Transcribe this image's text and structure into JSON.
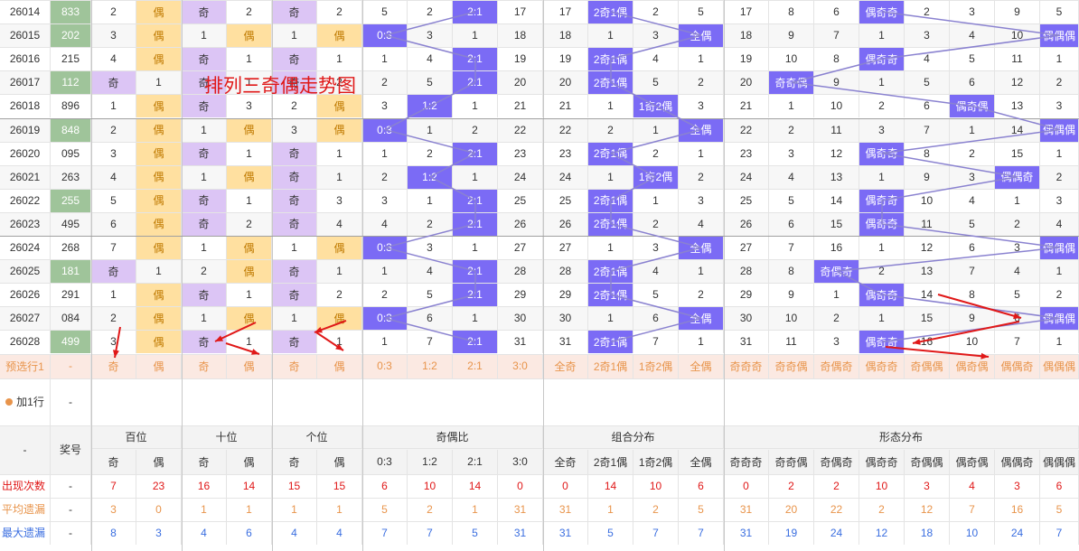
{
  "overlay_title": "排列三奇偶走势图",
  "rows": [
    [
      "26014",
      "833",
      "2",
      "偶",
      "奇",
      "2",
      "奇",
      "2",
      "5",
      "2",
      "2:1",
      "17",
      "17",
      "2奇1偶",
      "2",
      "5",
      "17",
      "8",
      "6",
      "偶奇奇",
      "2",
      "3",
      "9",
      "5"
    ],
    [
      "26015",
      "202",
      "3",
      "偶",
      "1",
      "偶",
      "1",
      "偶",
      "0:3",
      "3",
      "1",
      "18",
      "18",
      "1",
      "3",
      "全偶",
      "18",
      "9",
      "7",
      "1",
      "3",
      "4",
      "10",
      "偶偶偶"
    ],
    [
      "26016",
      "215",
      "4",
      "偶",
      "奇",
      "1",
      "奇",
      "1",
      "1",
      "4",
      "2:1",
      "19",
      "19",
      "2奇1偶",
      "4",
      "1",
      "19",
      "10",
      "8",
      "偶奇奇",
      "4",
      "5",
      "11",
      "1"
    ],
    [
      "26017",
      "112",
      "奇",
      "1",
      "奇",
      "1",
      "奇",
      "2",
      "2",
      "5",
      "2:1",
      "20",
      "20",
      "2奇1偶",
      "5",
      "2",
      "20",
      "奇奇偶",
      "9",
      "1",
      "5",
      "6",
      "12",
      "2"
    ],
    [
      "26018",
      "896",
      "1",
      "偶",
      "奇",
      "3",
      "2",
      "偶",
      "3",
      "1:2",
      "1",
      "21",
      "21",
      "1",
      "1奇2偶",
      "3",
      "21",
      "1",
      "10",
      "2",
      "6",
      "偶奇偶",
      "13",
      "3"
    ],
    [
      "26019",
      "848",
      "2",
      "偶",
      "1",
      "偶",
      "3",
      "偶",
      "0:3",
      "1",
      "2",
      "22",
      "22",
      "2",
      "1",
      "全偶",
      "22",
      "2",
      "11",
      "3",
      "7",
      "1",
      "14",
      "偶偶偶"
    ],
    [
      "26020",
      "095",
      "3",
      "偶",
      "奇",
      "1",
      "奇",
      "1",
      "1",
      "2",
      "2:1",
      "23",
      "23",
      "2奇1偶",
      "2",
      "1",
      "23",
      "3",
      "12",
      "偶奇奇",
      "8",
      "2",
      "15",
      "1"
    ],
    [
      "26021",
      "263",
      "4",
      "偶",
      "1",
      "偶",
      "奇",
      "1",
      "2",
      "1:2",
      "1",
      "24",
      "24",
      "1",
      "1奇2偶",
      "2",
      "24",
      "4",
      "13",
      "1",
      "9",
      "3",
      "偶偶奇",
      "2"
    ],
    [
      "26022",
      "255",
      "5",
      "偶",
      "奇",
      "1",
      "奇",
      "3",
      "3",
      "1",
      "2:1",
      "25",
      "25",
      "2奇1偶",
      "1",
      "3",
      "25",
      "5",
      "14",
      "偶奇奇",
      "10",
      "4",
      "1",
      "3"
    ],
    [
      "26023",
      "495",
      "6",
      "偶",
      "奇",
      "2",
      "奇",
      "4",
      "4",
      "2",
      "2:1",
      "26",
      "26",
      "2奇1偶",
      "2",
      "4",
      "26",
      "6",
      "15",
      "偶奇奇",
      "11",
      "5",
      "2",
      "4"
    ],
    [
      "26024",
      "268",
      "7",
      "偶",
      "1",
      "偶",
      "1",
      "偶",
      "0:3",
      "3",
      "1",
      "27",
      "27",
      "1",
      "3",
      "全偶",
      "27",
      "7",
      "16",
      "1",
      "12",
      "6",
      "3",
      "偶偶偶"
    ],
    [
      "26025",
      "181",
      "奇",
      "1",
      "2",
      "偶",
      "奇",
      "1",
      "1",
      "4",
      "2:1",
      "28",
      "28",
      "2奇1偶",
      "4",
      "1",
      "28",
      "8",
      "奇偶奇",
      "2",
      "13",
      "7",
      "4",
      "1"
    ],
    [
      "26026",
      "291",
      "1",
      "偶",
      "奇",
      "1",
      "奇",
      "2",
      "2",
      "5",
      "2:1",
      "29",
      "29",
      "2奇1偶",
      "5",
      "2",
      "29",
      "9",
      "1",
      "偶奇奇",
      "14",
      "8",
      "5",
      "2"
    ],
    [
      "26027",
      "084",
      "2",
      "偶",
      "1",
      "偶",
      "1",
      "偶",
      "0:3",
      "6",
      "1",
      "30",
      "30",
      "1",
      "6",
      "全偶",
      "30",
      "10",
      "2",
      "1",
      "15",
      "9",
      "6",
      "偶偶偶"
    ],
    [
      "26028",
      "499",
      "3",
      "偶",
      "奇",
      "1",
      "奇",
      "1",
      "1",
      "7",
      "2:1",
      "31",
      "31",
      "2奇1偶",
      "7",
      "1",
      "31",
      "11",
      "3",
      "偶奇奇",
      "16",
      "10",
      "7",
      "1"
    ]
  ],
  "preselect": {
    "label": "预选行1",
    "award": "-",
    "cells": [
      "奇",
      "偶",
      "奇",
      "偶",
      "奇",
      "偶",
      "0:3",
      "1:2",
      "2:1",
      "3:0",
      "全奇",
      "2奇1偶",
      "1奇2偶",
      "全偶",
      "奇奇奇",
      "奇奇偶",
      "奇偶奇",
      "偶奇奇",
      "奇偶偶",
      "偶奇偶",
      "偶偶奇",
      "偶偶偶"
    ]
  },
  "add_row": {
    "label": "加1行",
    "award": "-"
  },
  "header": {
    "dash": "-",
    "award": "奖号",
    "groups": [
      "百位",
      "十位",
      "个位",
      "奇偶比",
      "组合分布",
      "形态分布"
    ],
    "subs": [
      "奇",
      "偶",
      "奇",
      "偶",
      "奇",
      "偶",
      "0:3",
      "1:2",
      "2:1",
      "3:0",
      "全奇",
      "2奇1偶",
      "1奇2偶",
      "全偶",
      "奇奇奇",
      "奇奇偶",
      "奇偶奇",
      "偶奇奇",
      "奇偶偶",
      "偶奇偶",
      "偶偶奇",
      "偶偶偶"
    ]
  },
  "stats": [
    {
      "label": "出现次数",
      "award": "-",
      "vals": [
        "7",
        "23",
        "16",
        "14",
        "15",
        "15",
        "6",
        "10",
        "14",
        "0",
        "0",
        "14",
        "10",
        "6",
        "0",
        "2",
        "2",
        "10",
        "3",
        "4",
        "3",
        "6"
      ]
    },
    {
      "label": "平均遗漏",
      "award": "-",
      "vals": [
        "3",
        "0",
        "1",
        "1",
        "1",
        "1",
        "5",
        "2",
        "1",
        "31",
        "31",
        "1",
        "2",
        "5",
        "31",
        "20",
        "22",
        "2",
        "12",
        "7",
        "16",
        "5"
      ]
    },
    {
      "label": "最大遗漏",
      "award": "-",
      "vals": [
        "8",
        "3",
        "4",
        "6",
        "4",
        "4",
        "7",
        "7",
        "5",
        "31",
        "31",
        "5",
        "7",
        "7",
        "31",
        "19",
        "24",
        "12",
        "18",
        "10",
        "24",
        "7"
      ]
    }
  ],
  "colors": {
    "accent": "#7b6bf5",
    "award": "#9fc49a",
    "odd": "#dcc5f5",
    "even": "#ffe0a0",
    "line": "#8a82d0",
    "arrow": "#e01818",
    "title": "#e01818"
  }
}
